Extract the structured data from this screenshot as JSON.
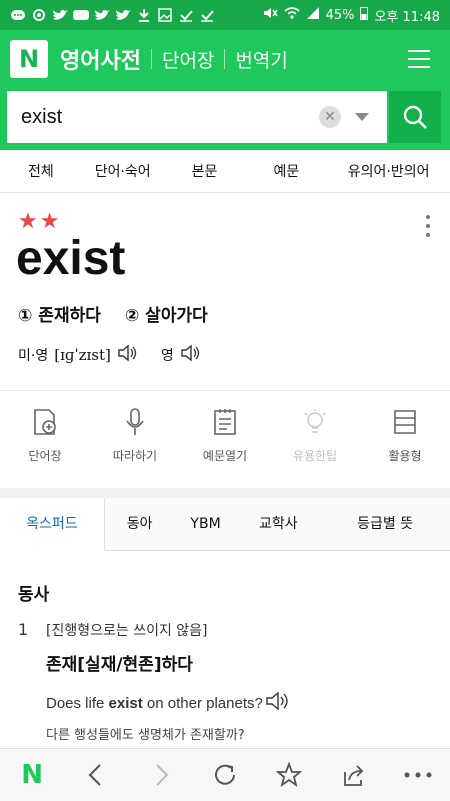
{
  "status_bar": {
    "battery": "45%",
    "time": "오후 11:48"
  },
  "header": {
    "logo": "N",
    "title": "영어사전",
    "links": [
      "단어장",
      "번역기"
    ]
  },
  "search": {
    "value": "exist",
    "placeholder": ""
  },
  "tabs": [
    "전체",
    "단어·숙어",
    "본문",
    "예문",
    "유의어·반의어"
  ],
  "entry": {
    "stars": "★★",
    "word": "exist",
    "meanings": [
      "① 존재하다",
      "② 살아가다"
    ],
    "pron_us_label": "미·영",
    "pron_us": "[ɪɡˈzɪst]",
    "pron_uk_label": "영"
  },
  "actions": [
    {
      "label": "단어장",
      "icon": "add-to-wordbook-icon",
      "enabled": true
    },
    {
      "label": "따라하기",
      "icon": "microphone-icon",
      "enabled": true
    },
    {
      "label": "예문열기",
      "icon": "notepad-icon",
      "enabled": true
    },
    {
      "label": "유용한팁",
      "icon": "lightbulb-icon",
      "enabled": false
    },
    {
      "label": "활용형",
      "icon": "conjugation-icon",
      "enabled": true
    }
  ],
  "dict_tabs": [
    "옥스퍼드",
    "동아",
    "YBM",
    "교학사",
    "등급별 뜻"
  ],
  "definition": {
    "part_of_speech": "동사",
    "number": "1",
    "note": "[진행형으로는 쓰이지 않음]",
    "meaning": "존재[실재/현존]하다",
    "example_pre": "Does life ",
    "example_word": "exist",
    "example_post": " on other planets?",
    "translation": "다른 행성들에도 생명체가 존재할까?"
  },
  "colors": {
    "brand_green": "#1ec85a",
    "star_red": "#e84a4a",
    "active_tab_blue": "#0f6ab3"
  }
}
